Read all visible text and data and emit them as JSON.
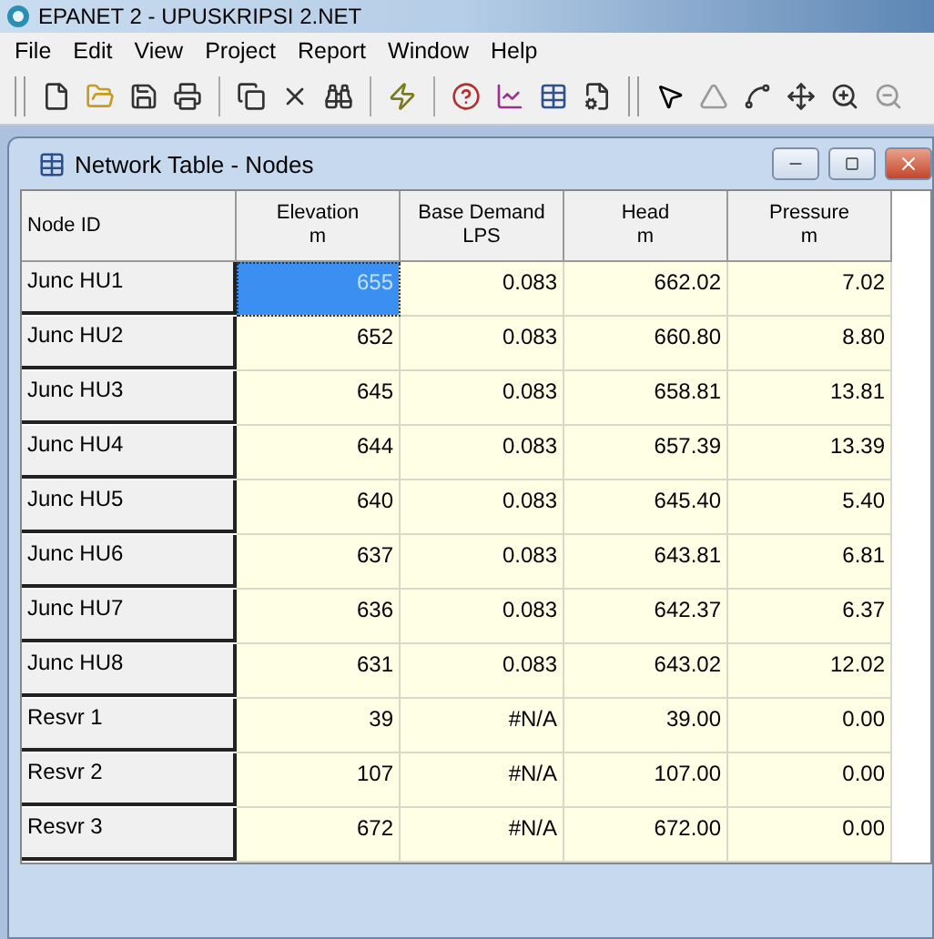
{
  "window": {
    "title": "EPANET 2 - UPUSKRIPSI 2.NET"
  },
  "menu": [
    "File",
    "Edit",
    "View",
    "Project",
    "Report",
    "Window",
    "Help"
  ],
  "table_window": {
    "title": "Network Table - Nodes"
  },
  "table": {
    "columns": [
      {
        "title": "Node ID"
      },
      {
        "title": "Elevation",
        "unit": "m"
      },
      {
        "title": "Base Demand",
        "unit": "LPS"
      },
      {
        "title": "Head",
        "unit": "m"
      },
      {
        "title": "Pressure",
        "unit": "m"
      }
    ],
    "rows": [
      {
        "cells": [
          {
            "value": "Junc HU1",
            "selected": false
          },
          {
            "value": "655",
            "selected": true
          },
          {
            "value": "0.083",
            "selected": false
          },
          {
            "value": "662.02",
            "selected": false
          },
          {
            "value": "7.02",
            "selected": false
          }
        ]
      },
      {
        "cells": [
          {
            "value": "Junc HU2",
            "selected": false
          },
          {
            "value": "652",
            "selected": false
          },
          {
            "value": "0.083",
            "selected": false
          },
          {
            "value": "660.80",
            "selected": false
          },
          {
            "value": "8.80",
            "selected": false
          }
        ]
      },
      {
        "cells": [
          {
            "value": "Junc HU3",
            "selected": false
          },
          {
            "value": "645",
            "selected": false
          },
          {
            "value": "0.083",
            "selected": false
          },
          {
            "value": "658.81",
            "selected": false
          },
          {
            "value": "13.81",
            "selected": false
          }
        ]
      },
      {
        "cells": [
          {
            "value": "Junc HU4",
            "selected": false
          },
          {
            "value": "644",
            "selected": false
          },
          {
            "value": "0.083",
            "selected": false
          },
          {
            "value": "657.39",
            "selected": false
          },
          {
            "value": "13.39",
            "selected": false
          }
        ]
      },
      {
        "cells": [
          {
            "value": "Junc HU5",
            "selected": false
          },
          {
            "value": "640",
            "selected": false
          },
          {
            "value": "0.083",
            "selected": false
          },
          {
            "value": "645.40",
            "selected": false
          },
          {
            "value": "5.40",
            "selected": false
          }
        ]
      },
      {
        "cells": [
          {
            "value": "Junc HU6",
            "selected": false
          },
          {
            "value": "637",
            "selected": false
          },
          {
            "value": "0.083",
            "selected": false
          },
          {
            "value": "643.81",
            "selected": false
          },
          {
            "value": "6.81",
            "selected": false
          }
        ]
      },
      {
        "cells": [
          {
            "value": "Junc HU7",
            "selected": false
          },
          {
            "value": "636",
            "selected": false
          },
          {
            "value": "0.083",
            "selected": false
          },
          {
            "value": "642.37",
            "selected": false
          },
          {
            "value": "6.37",
            "selected": false
          }
        ]
      },
      {
        "cells": [
          {
            "value": "Junc HU8",
            "selected": false
          },
          {
            "value": "631",
            "selected": false
          },
          {
            "value": "0.083",
            "selected": false
          },
          {
            "value": "643.02",
            "selected": false
          },
          {
            "value": "12.02",
            "selected": false
          }
        ]
      },
      {
        "cells": [
          {
            "value": "Resvr 1",
            "selected": false
          },
          {
            "value": "39",
            "selected": false
          },
          {
            "value": "#N/A",
            "selected": false
          },
          {
            "value": "39.00",
            "selected": false
          },
          {
            "value": "0.00",
            "selected": false
          }
        ]
      },
      {
        "cells": [
          {
            "value": "Resvr 2",
            "selected": false
          },
          {
            "value": "107",
            "selected": false
          },
          {
            "value": "#N/A",
            "selected": false
          },
          {
            "value": "107.00",
            "selected": false
          },
          {
            "value": "0.00",
            "selected": false
          }
        ]
      },
      {
        "cells": [
          {
            "value": "Resvr 3",
            "selected": false
          },
          {
            "value": "672",
            "selected": false
          },
          {
            "value": "#N/A",
            "selected": false
          },
          {
            "value": "672.00",
            "selected": false
          },
          {
            "value": "0.00",
            "selected": false
          }
        ]
      }
    ]
  }
}
